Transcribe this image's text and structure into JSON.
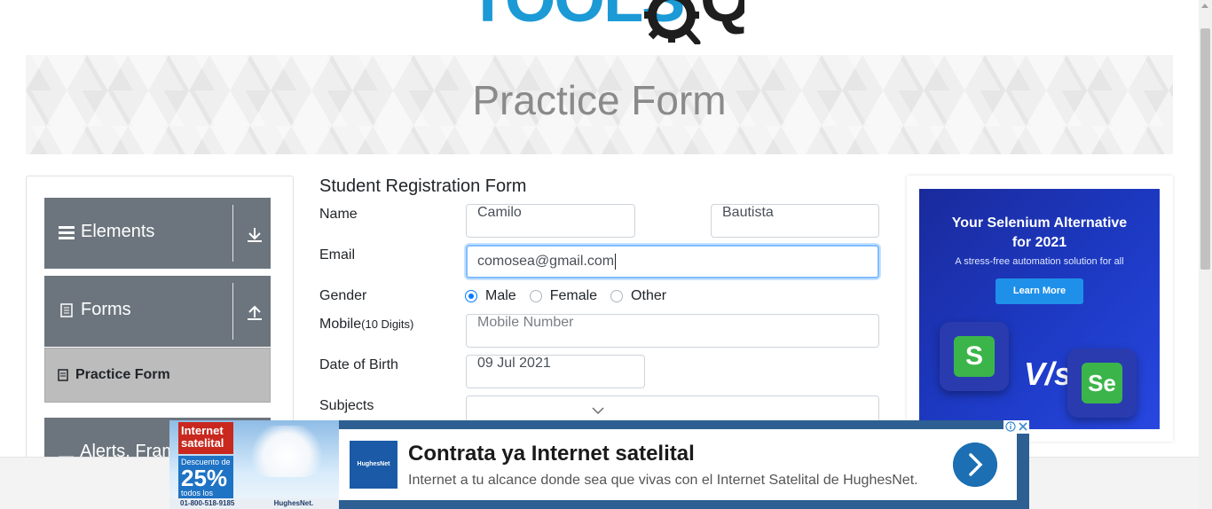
{
  "logo": {
    "text": "TOOLS",
    "qa": "QA"
  },
  "banner": {
    "title": "Practice Form"
  },
  "sidebar": {
    "groups": [
      {
        "label": "Elements",
        "icon": "hamburger-icon",
        "toggle": "chevron-down"
      },
      {
        "label": "Forms",
        "icon": "document-icon",
        "toggle": "chevron-up"
      },
      {
        "label": "Alerts, Frame & Windows",
        "icon": "window-icon"
      }
    ],
    "active_item": {
      "label": "Practice Form",
      "icon": "form-icon"
    }
  },
  "form": {
    "title": "Student Registration Form",
    "name_label": "Name",
    "first_name": "Camilo",
    "last_name": "Bautista",
    "email_label": "Email",
    "email_value": "comosea@gmail.com",
    "gender_label": "Gender",
    "genders": [
      "Male",
      "Female",
      "Other"
    ],
    "selected_gender": "Male",
    "mobile_label": "Mobile",
    "mobile_hint": "(10 Digits)",
    "mobile_placeholder": "Mobile Number",
    "dob_label": "Date of Birth",
    "dob_value": "09 Jul 2021",
    "subjects_label": "Subjects"
  },
  "ad_right": {
    "headline_1": "Your Selenium Alternative",
    "headline_2": "for 2021",
    "sub": "A stress-free automation solution for all",
    "cta": "Learn More",
    "vs": "V/s",
    "left_tile": "S",
    "right_tile": "Se",
    "bg_color": "#1d3ac4"
  },
  "ad_bottom": {
    "badge_title": "Internet satelital",
    "badge_discount": "Descuento de",
    "badge_pct": "25%",
    "badge_note": "todos los planes",
    "phone": "01-800-518-9185",
    "brand": "HughesNet",
    "brand_small": "HughesNet.",
    "title": "Contrata ya Internet satelital",
    "desc": "Internet a tu alcance donde sea que vivas con el Internet Satelital de HughesNet."
  }
}
